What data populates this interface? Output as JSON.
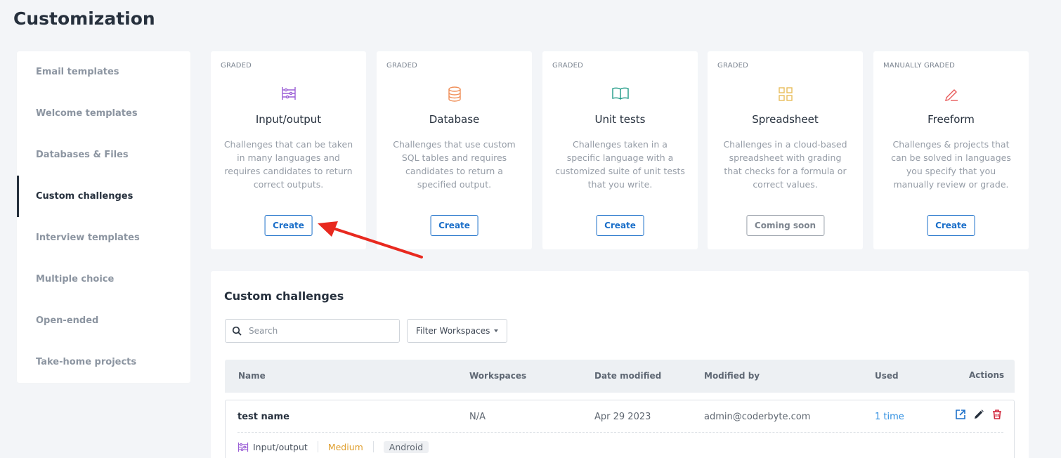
{
  "page": {
    "title": "Customization"
  },
  "sidebar": {
    "items": [
      {
        "label": "Email templates"
      },
      {
        "label": "Welcome templates"
      },
      {
        "label": "Databases & Files"
      },
      {
        "label": "Custom challenges",
        "active": true
      },
      {
        "label": "Interview templates"
      },
      {
        "label": "Multiple choice"
      },
      {
        "label": "Open-ended"
      },
      {
        "label": "Take-home projects"
      }
    ]
  },
  "cards": [
    {
      "tag": "GRADED",
      "icon": "abacus-icon",
      "icon_color": "#9b5fd6",
      "title": "Input/output",
      "description": "Challenges that can be taken in many languages and requires candidates to return correct outputs.",
      "button": "Create"
    },
    {
      "tag": "GRADED",
      "icon": "database-icon",
      "icon_color": "#f0905a",
      "title": "Database",
      "description": "Challenges that use custom SQL tables and requires candidates to return a specified output.",
      "button": "Create"
    },
    {
      "tag": "GRADED",
      "icon": "open-book-icon",
      "icon_color": "#1e9a86",
      "title": "Unit tests",
      "description": "Challenges taken in a specific language with a customized suite of unit tests that you write.",
      "button": "Create"
    },
    {
      "tag": "GRADED",
      "icon": "grid-icon",
      "icon_color": "#e8bd5a",
      "title": "Spreadsheet",
      "description": "Challenges in a cloud-based spreadsheet with grading that checks for a formula or correct values.",
      "button": "Coming soon"
    },
    {
      "tag": "MANUALLY GRADED",
      "icon": "pencil-icon",
      "icon_color": "#e85a5a",
      "title": "Freeform",
      "description": "Challenges & projects that can be solved in languages you specify that you manually review or grade.",
      "button": "Create"
    }
  ],
  "main": {
    "title": "Custom challenges",
    "search_placeholder": "Search",
    "filter_label": "Filter Workspaces",
    "columns": {
      "name": "Name",
      "workspaces": "Workspaces",
      "date_modified": "Date modified",
      "modified_by": "Modified by",
      "used": "Used",
      "actions": "Actions"
    },
    "rows": [
      {
        "name": "test name",
        "workspaces": "N/A",
        "date_modified": "Apr 29 2023",
        "modified_by": "admin@coderbyte.com",
        "used": "1 time",
        "type": "Input/output",
        "difficulty": "Medium",
        "language": "Android"
      }
    ]
  },
  "colors": {
    "accent": "#1b6fc9",
    "link": "#2e8ee0",
    "medium": "#e0a030",
    "annotation_arrow": "#e8291f"
  }
}
